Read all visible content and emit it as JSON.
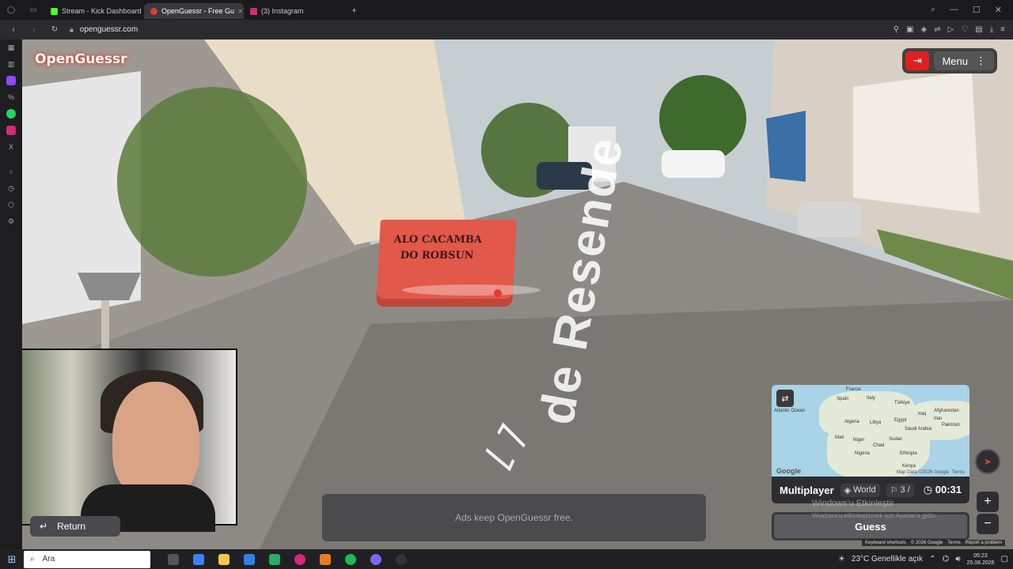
{
  "browser": {
    "tabs": [
      {
        "label": "Stream - Kick Dashboard",
        "color": "#53fc18"
      },
      {
        "label": "OpenGuessr - Free Gu",
        "color": "#e53935",
        "active": true
      },
      {
        "label": "(3) Instagram",
        "color": "#d62976"
      }
    ],
    "new_tab": "+",
    "url": "openguessr.com"
  },
  "game": {
    "logo": "OpenGuessr",
    "menu_label": "Menu",
    "dumpster_line1": "ALO CACAMBA",
    "dumpster_line2": "DO ROBSUN",
    "road_text": "de Resende",
    "return_label": "Return",
    "ad_text": "Ads keep OpenGuessr free.",
    "map": {
      "labels": [
        "France",
        "Spain",
        "Italy",
        "Türkiye",
        "Iraq",
        "Iran",
        "Algeria",
        "Libya",
        "Egypt",
        "Saudi Arabia",
        "Sudan",
        "Mali",
        "Niger",
        "Chad",
        "Nigeria",
        "Ethiopia",
        "Afghanistan",
        "Pakistan",
        "Kenya",
        "Atlantic Ocean"
      ],
      "google": "Google",
      "map_data": "Map Data ©2026 Google",
      "terms": "Terms"
    },
    "mode": "Multiplayer",
    "region": "World",
    "round": "3 /",
    "timer": "00:31",
    "guess_label": "Guess",
    "watermark_title": "Windows'u Etkinleştir",
    "watermark_sub": "Windows'u etkinleştirmek için Ayarlar'a gidin.",
    "footer": [
      "Keyboard shortcuts",
      "© 2026 Google",
      "Terms",
      "Report a problem"
    ]
  },
  "taskbar": {
    "search_placeholder": "Ara",
    "weather": "23°C  Genellikle açık",
    "time": "05:23",
    "date": "25.08.2026"
  }
}
